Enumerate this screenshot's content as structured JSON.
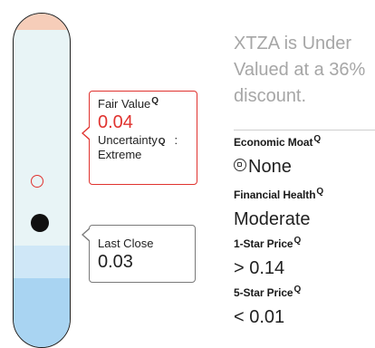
{
  "fair_value": {
    "label": "Fair Value",
    "value": "0.04",
    "uncertainty_label": "Uncertainty",
    "uncertainty_colon": ":",
    "uncertainty_value": "Extreme",
    "info_glyph": "Q"
  },
  "last_close": {
    "label": "Last Close",
    "value": "0.03"
  },
  "summary": "XTZA is Under Valued at a 36% discount.",
  "metrics": {
    "moat": {
      "title": "Economic Moat",
      "value": "None",
      "icon": "moat-icon"
    },
    "health": {
      "title": "Financial Health",
      "value": "Moderate"
    },
    "one_star": {
      "title": "1-Star Price",
      "value": "> 0.14"
    },
    "five_star": {
      "title": "5-Star Price",
      "value": "< 0.01"
    }
  },
  "colors": {
    "accent_red": "#e0332f",
    "overvalued_band": "#f6cdb9",
    "fair_band": "#e8f4f6",
    "undervalued_band_light": "#cfe7f7",
    "undervalued_band_dark": "#a9d4f2"
  }
}
